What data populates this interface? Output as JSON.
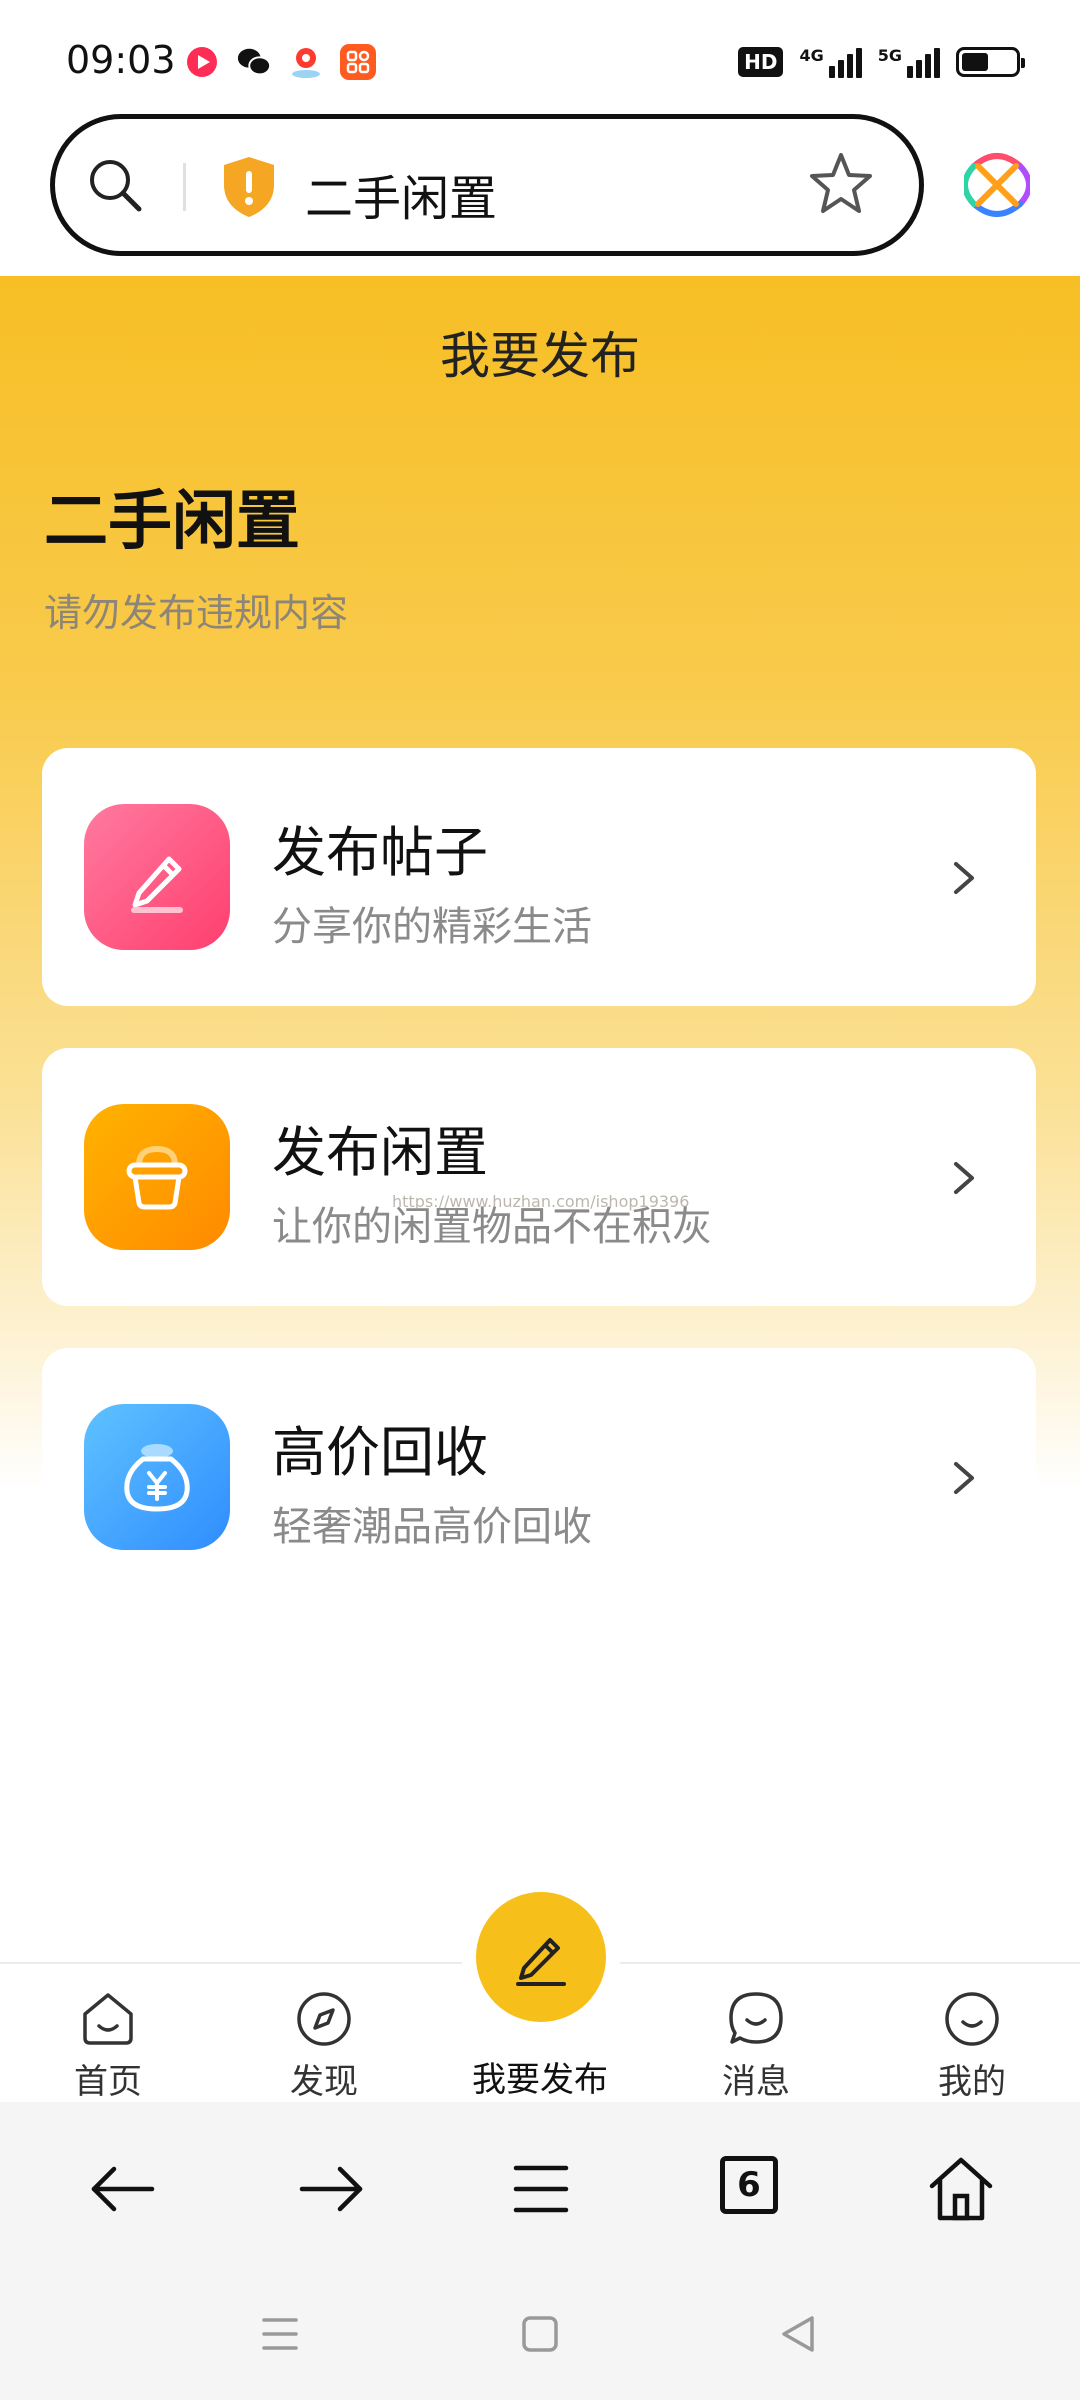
{
  "status_bar": {
    "time": "09:03",
    "hd_badge": "HD",
    "signal_1_label": "4G",
    "signal_2_label": "5G",
    "app_icons": [
      "video-app-icon",
      "wechat-icon",
      "map-app-icon",
      "shopping-app-icon"
    ]
  },
  "address_bar": {
    "text": "二手闲置",
    "icons": [
      "search-icon",
      "security-shield-icon",
      "star-icon",
      "browser-logo-icon"
    ]
  },
  "page": {
    "header_title": "我要发布",
    "section_title": "二手闲置",
    "section_subtitle": "请勿发布违规内容",
    "watermark": "https://www.huzhan.com/ishop19396"
  },
  "cards": [
    {
      "title": "发布帖子",
      "desc": "分享你的精彩生活",
      "icon": "pencil-icon",
      "color": "#ff4f7b"
    },
    {
      "title": "发布闲置",
      "desc": "让你的闲置物品不在积灰",
      "icon": "basket-icon",
      "color": "#ff9a00"
    },
    {
      "title": "高价回收",
      "desc": "轻奢潮品高价回收",
      "icon": "money-bag-icon",
      "color": "#3aa6ff"
    }
  ],
  "tabbar": {
    "items": [
      {
        "label": "首页",
        "icon": "home-smile-icon"
      },
      {
        "label": "发现",
        "icon": "compass-icon"
      },
      {
        "label": "我要发布",
        "icon": "pencil-icon"
      },
      {
        "label": "消息",
        "icon": "chat-bubble-icon"
      },
      {
        "label": "我的",
        "icon": "smile-face-icon"
      }
    ],
    "accent": "#f7bf1a"
  },
  "browser_nav": {
    "tab_count": "6",
    "buttons": [
      "back-arrow-icon",
      "forward-arrow-icon",
      "menu-icon",
      "tabs-icon",
      "home-icon"
    ]
  },
  "system_nav": {
    "buttons": [
      "recent-apps-icon",
      "home-square-icon",
      "back-triangle-icon"
    ]
  }
}
